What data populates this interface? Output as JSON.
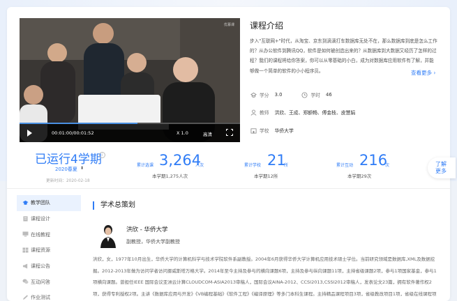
{
  "video": {
    "time": "00:01:00/00:01:52",
    "speed": "X 1.0",
    "quality": "高清",
    "progress": 0.535,
    "watermark": "优慕课"
  },
  "intro": {
    "title": "课程介绍",
    "text": "步入\"互联网+\"时代，从淘宝、京东到滴滴打车数据库无处不在，那么数据库到底是怎么工作的？从办公软件到腾讯QQ，软件是如何被创造出来的？从数据库到大数据又经历了怎样的过程？我们的课程将给你答案，你可以从零基础的小白，成为对数据库应用软件有了解，并能够做一个简单的软件的小小程序员。",
    "more": "查看更多 ›",
    "credits_label": "学分",
    "credits": "3.0",
    "hours_label": "学时",
    "hours": "46",
    "teachers_label": "教师",
    "teachers": "洪欣、王成、郑额畅、傅金枝、皮慧娟",
    "school_label": "学校",
    "school": "华侨大学"
  },
  "stats": {
    "run_title": "已运行4学期",
    "semester": "2020春夏",
    "updated": "更新时间：2020-02-18",
    "visits_label": "累计选课",
    "visits": "3,264",
    "visits_unit": "人次",
    "visits_sub": "本学期1,275人次",
    "schools_label": "累计学校",
    "schools": "21",
    "schools_unit": "所",
    "schools_sub": "本学期12所",
    "interact_label": "累计互动",
    "interact": "216",
    "interact_unit": "次",
    "interact_sub": "本学期29次",
    "more_bubble": [
      "了解",
      "更多"
    ]
  },
  "sidebar": {
    "items": [
      {
        "label": "教学团队"
      },
      {
        "label": "课程设计"
      },
      {
        "label": "在线教程"
      },
      {
        "label": "课程资源"
      },
      {
        "label": "课程公告"
      },
      {
        "label": "互动问答"
      },
      {
        "label": "作业测试"
      }
    ]
  },
  "team": {
    "section_title": "学术总策划",
    "name": "洪欣 - 华侨大学",
    "role": "副教授，华侨大学副教授",
    "bio": "洪欣，女，1977年10月出生，华侨大学的计算机科学与技术学院软件系副教授。2004年6月获得华侨大学计算机应用技术硕士学位。当前研究领域是数据库,XML及数据挖掘。2012-2013年做为访问学者访问挪威斯塔万格大学。2014年至今主持及参与的横向课题6项，主持及参与纵向课题11项，主持省级课题2项，参与1项国家基金，参与1项横向课题。曾担任IEEE 国际会议亚洲云计算CLOUDCOM-ASIA2013审稿人，国际会议AINA-2012、CCSI2013,CSSI2012审稿人，发表论文23篇，拥有软件著作权2项，获得专利授权2项。主讲《数据库应用与开发》《VB编程基础》《软件工程》《编译原理》等多门本科生课程。主持精品课程项目3项，省级教改项目1项，省级在线课程项目1项，教材建设项目2项，独撰教材1部，参与编写教材5部，获得校级"
  },
  "colors": {
    "accent": "#2f7cf6",
    "active_bg": "#eaf2fe"
  }
}
